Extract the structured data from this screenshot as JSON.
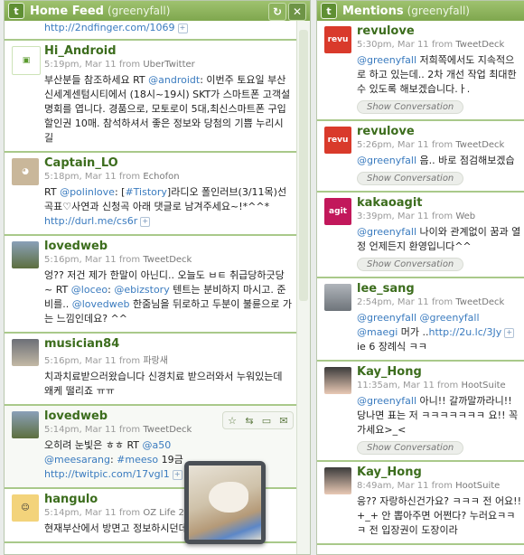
{
  "col1": {
    "title": "Home Feed",
    "account": "(greenyfall)"
  },
  "col2": {
    "title": "Mentions",
    "account": "(greenyfall)"
  },
  "icons": {
    "twitter": "twitter-icon",
    "refresh": "refresh-icon",
    "close": "close-icon",
    "plus": "plus-icon",
    "star": "star-icon",
    "retweet": "retweet-icon",
    "reply": "reply-icon",
    "dm": "direct-message-icon"
  },
  "home": {
    "top_link": "http://2ndfinger.com/1069",
    "tweets": [
      {
        "user": "Hi_Android",
        "time": "5:19pm, Mar 11",
        "from": "from",
        "source": "UberTwitter",
        "t1": "부산분들 참조하세요 RT ",
        "m1": "@androidt",
        "t2": ": 이번주 토요일 부산신세계센텀시티에서 (18시~19시) SKT가 스마트폰 고객설명회를 엽니다. 경품으로, 모토로이 5대,최신스마트폰 구입할인권 10매. 참석하셔서 좋은 정보와 당첨의 기쁨 누리시길"
      },
      {
        "user": "Captain_LO",
        "time": "5:18pm, Mar 11",
        "from": "from",
        "source": "Echofon",
        "t1": "RT ",
        "m1": "@polinlove",
        "t2": ": [",
        "m2": "#Tistory",
        "t3": "]라디오 폴인러브(3/11목)선곡표♡사연과 신청곡 아래 댓글로 남겨주세요~!*^^* ",
        "l1": "http://durl.me/cs6r"
      },
      {
        "user": "lovedweb",
        "time": "5:16pm, Mar 11",
        "from": "from",
        "source": "TweetDeck",
        "t1": "엉?? 저건 제가 한말이 아닌디.. 오늘도 ㅂㅌ 취급당하긋당~ RT ",
        "m1": "@loceo",
        "t2": ": ",
        "m2": "@ebizstory",
        "t3": " 텐트는 분비하지 마시고. 준비를.. ",
        "m3": "@lovedweb",
        "t4": " 한줌님을 뒤로하고 두분이 불륜으로 가는 느낌인데요? ^^"
      },
      {
        "user": "musician84",
        "time": "5:16pm, Mar 11",
        "from": "from",
        "source": "파랑새",
        "t1": "치과치료받으러왔습니다 신경치료 받으러와서 누워있는데 왜케 떨리죠 ㅠㅠ"
      },
      {
        "user": "lovedweb",
        "time": "5:14pm, Mar 11",
        "from": "from",
        "source": "TweetDeck",
        "t1": "오히려 눈빛은 ㅎㅎ RT ",
        "m1": "@a50",
        "t2": "",
        "m2": "@meesarang",
        "t3": ": ",
        "h1": "#meeso",
        "t4": " 19금",
        "l1": "http://twitpic.com/17vgl1"
      },
      {
        "user": "hangulo",
        "time": "5:14pm, Mar 11",
        "from": "from",
        "source": "OZ Life 24",
        "t1": "현재부산에서 방면고 정보하시던데 ..."
      }
    ]
  },
  "mentions": {
    "show_conv": "Show Conversation",
    "tweets": [
      {
        "user": "revulove",
        "time": "5:30pm, Mar 11",
        "from": "from",
        "source": "TweetDeck",
        "m1": "@greenyfall",
        "t1": " 저희쪽에서도 지속적으로 하고 있는데.. 2차 개선 작업 최대한 수 있도록 해보겠습니다.ㅏ."
      },
      {
        "user": "revulove",
        "time": "5:26pm, Mar 11",
        "from": "from",
        "source": "TweetDeck",
        "m1": "@greenyfall",
        "t1": " 음.. 바로 점검해보겠습"
      },
      {
        "user": "kakaoagit",
        "time": "3:39pm, Mar 11",
        "from": "from",
        "source": "Web",
        "m1": "@greenyfall",
        "t1": " 나이와 관계없이 꿈과 열정 언제든지 환영입니다^^"
      },
      {
        "user": "lee_sang",
        "time": "2:54pm, Mar 11",
        "from": "from",
        "source": "TweetDeck",
        "m1": "@greenyfall",
        "t1": " ",
        "m2": "@greenyfall",
        "t2": " ",
        "m3": "@maegi",
        "t3": " 머가 ..",
        "l1": "http://2u.lc/3Jy",
        "t4": " ie 6 장례식 ㅋㅋ"
      },
      {
        "user": "Kay_Hong",
        "time": "11:35am, Mar 11",
        "from": "from",
        "source": "HootSuite",
        "m1": "@greenyfall",
        "t1": " 아니!! 갈까말까라니!! 당나면 표는 저 ㅋㅋㅋㅋㅋㅋㅋ 요!! 꼭 가세요>_<"
      },
      {
        "user": "Kay_Hong",
        "time": "8:49am, Mar 11",
        "from": "from",
        "source": "HootSuite",
        "t1": "응?? 자랑하신건가요? ㅋㅋㅋ 전 어요!! +_+ 안 뽑아주면 어쩐다? 누러요ㅋㅋㅋ 전 입장권이 도장이라"
      }
    ]
  }
}
